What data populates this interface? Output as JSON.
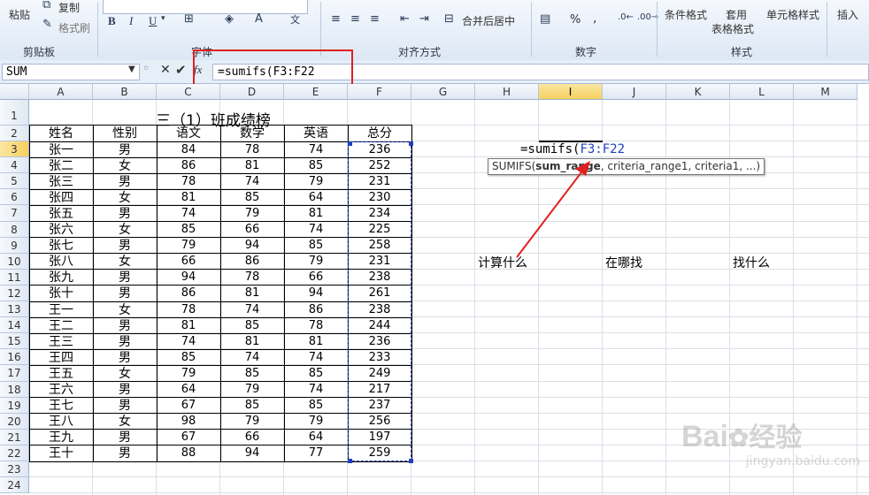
{
  "ribbon": {
    "paste_label": "粘贴",
    "copy_label": "复制",
    "format_painter_label": "格式刷",
    "merge_center_label": "合并后居中",
    "percent_label": "%",
    "comma_label": ",",
    "conditional_format_label": "条件格式",
    "table_format_label_1": "套用",
    "table_format_label_2": "表格格式",
    "cell_style_label": "单元格样式",
    "insert_label": "插入",
    "groups": {
      "clipboard": "剪贴板",
      "font": "字体",
      "alignment": "对齐方式",
      "number": "数字",
      "styles": "样式"
    },
    "bold": "B",
    "italic": "I",
    "underline": "U"
  },
  "formula_bar": {
    "name_box": "SUM",
    "formula": "=sumifs(F3:F22"
  },
  "columns": [
    "A",
    "B",
    "C",
    "D",
    "E",
    "F",
    "G",
    "H",
    "I",
    "J",
    "K",
    "L",
    "M"
  ],
  "selected_column": "I",
  "rows": [
    "1",
    "2",
    "3",
    "4",
    "5",
    "6",
    "7",
    "8",
    "9",
    "10",
    "11",
    "12",
    "13",
    "14",
    "15",
    "16",
    "17",
    "18",
    "19",
    "20",
    "21",
    "22",
    "23",
    "24"
  ],
  "selected_row": "3",
  "sheet": {
    "title": "三（1）班成绩榜",
    "headers": [
      "姓名",
      "性别",
      "语文",
      "数学",
      "英语",
      "总分"
    ],
    "data": [
      [
        "张一",
        "男",
        "84",
        "78",
        "74",
        "236"
      ],
      [
        "张二",
        "女",
        "86",
        "81",
        "85",
        "252"
      ],
      [
        "张三",
        "男",
        "78",
        "74",
        "79",
        "231"
      ],
      [
        "张四",
        "女",
        "81",
        "85",
        "64",
        "230"
      ],
      [
        "张五",
        "男",
        "74",
        "79",
        "81",
        "234"
      ],
      [
        "张六",
        "女",
        "85",
        "66",
        "74",
        "225"
      ],
      [
        "张七",
        "男",
        "79",
        "94",
        "85",
        "258"
      ],
      [
        "张八",
        "女",
        "66",
        "86",
        "79",
        "231"
      ],
      [
        "张九",
        "男",
        "94",
        "78",
        "66",
        "238"
      ],
      [
        "张十",
        "男",
        "86",
        "81",
        "94",
        "261"
      ],
      [
        "王一",
        "女",
        "78",
        "74",
        "86",
        "238"
      ],
      [
        "王二",
        "男",
        "81",
        "85",
        "78",
        "244"
      ],
      [
        "王三",
        "男",
        "74",
        "81",
        "81",
        "236"
      ],
      [
        "王四",
        "男",
        "85",
        "74",
        "74",
        "233"
      ],
      [
        "王五",
        "女",
        "79",
        "85",
        "85",
        "249"
      ],
      [
        "王六",
        "男",
        "64",
        "79",
        "74",
        "217"
      ],
      [
        "王七",
        "男",
        "67",
        "85",
        "85",
        "237"
      ],
      [
        "王八",
        "女",
        "98",
        "79",
        "79",
        "256"
      ],
      [
        "王九",
        "男",
        "67",
        "66",
        "64",
        "197"
      ],
      [
        "王十",
        "男",
        "88",
        "94",
        "77",
        "259"
      ]
    ],
    "edit_prefix": "=sumifs(",
    "edit_ref": "F3:F22",
    "tooltip_prefix": "SUMIFS(",
    "tooltip_bold": "sum_range",
    "tooltip_rest": ", criteria_range1, criteria1, ...)",
    "label_what": "计算什么",
    "label_where": "在哪找",
    "label_find": "找什么"
  },
  "watermark": {
    "brand": "Bai",
    "brand2": "经验",
    "url": "jingyan.baidu.com"
  },
  "colors": {
    "annotation_red": "#e02020",
    "ref_blue": "#1f3fbf",
    "selection_gold": "#f6cf5f"
  }
}
